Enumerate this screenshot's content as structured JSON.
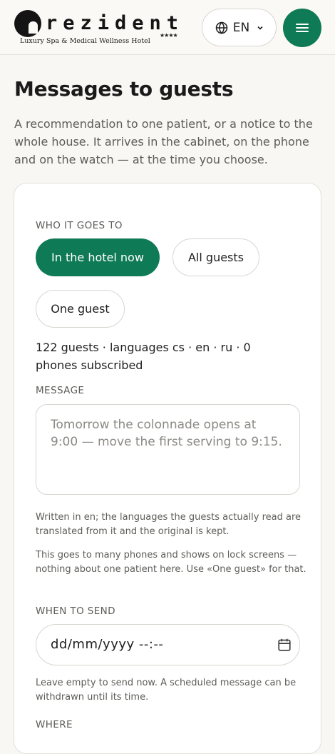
{
  "header": {
    "logo_word": "rezident",
    "logo_tagline": "Luxury Spa & Medical Wellness Hotel",
    "logo_stars": "★★★★",
    "language_label": "EN"
  },
  "page": {
    "title": "Messages to guests",
    "intro": "A recommendation to one patient, or a notice to the whole house. It arrives in the cabinet, on the phone and on the watch — at the time you choose."
  },
  "form": {
    "audience": {
      "label": "WHO IT GOES TO",
      "options": [
        "In the hotel now",
        "All guests",
        "One guest"
      ],
      "selected": "In the hotel now"
    },
    "stats": "122 guests · languages cs · en · ru · 0 phones subscribed",
    "message": {
      "label": "MESSAGE",
      "value": "",
      "placeholder": "Tomorrow the colonnade opens at 9:00 — move the first serving to 9:15."
    },
    "translation_hint": "Written in en; the languages the guests actually read are translated from it and the original is kept.",
    "privacy_hint": "This goes to many phones and shows on lock screens — nothing about one patient here. Use «One guest» for that.",
    "schedule": {
      "label": "WHEN TO SEND",
      "placeholder": "dd/mm/yyyy --:--",
      "hint": "Leave empty to send now. A scheduled message can be withdrawn until its time."
    },
    "where_label": "WHERE"
  },
  "colors": {
    "accent": "#0f7a56",
    "background": "#f8f7f3",
    "card": "#ffffff",
    "muted_text": "#5d5c58"
  },
  "icons": [
    "logo-mark-icon",
    "globe-icon",
    "chevron-down-icon",
    "menu-icon",
    "calendar-icon"
  ]
}
